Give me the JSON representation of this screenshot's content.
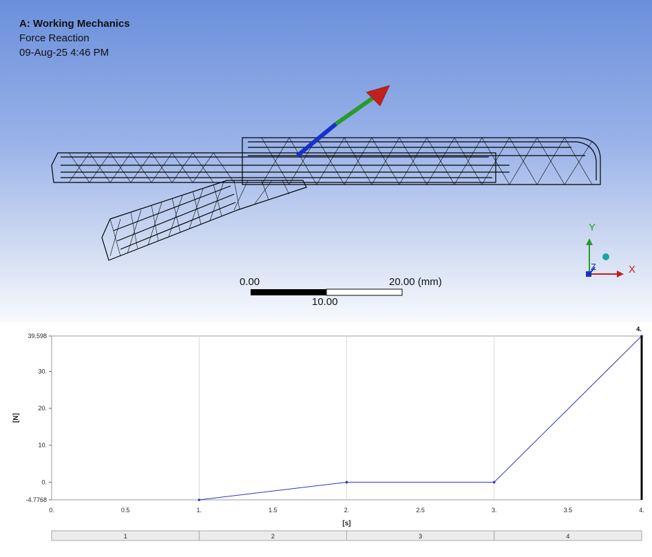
{
  "viewport": {
    "project": "A: Working Mechanics",
    "result": "Force Reaction",
    "timestamp": "09-Aug-25 4:46 PM",
    "scale": {
      "left": "0.00",
      "mid": "10.00",
      "right": "20.00",
      "unit": "(mm)"
    },
    "triad": {
      "x": "X",
      "y": "Y",
      "z": "Z"
    }
  },
  "colors": {
    "arrow_red": "#c0201e",
    "arrow_green": "#2a9a2a",
    "arrow_blue": "#1633c4",
    "series": "#2d32c8"
  },
  "chart_data": {
    "type": "line",
    "xlabel": "[s]",
    "ylabel": "[N]",
    "x": [
      1,
      2,
      3,
      4
    ],
    "y": [
      -4.7768,
      0,
      0,
      39.598
    ],
    "xlim": [
      0,
      4
    ],
    "ylim": [
      -4.7768,
      39.598
    ],
    "xticks": [
      "0.",
      "0.5",
      "1.",
      "1.5",
      "2.",
      "2.5",
      "3.",
      "3.5",
      "4."
    ],
    "yticks": [
      {
        "v": 39.598,
        "label": "39.598"
      },
      {
        "v": 30,
        "label": "30."
      },
      {
        "v": 20,
        "label": "20."
      },
      {
        "v": 10,
        "label": "10."
      },
      {
        "v": 0,
        "label": "0."
      },
      {
        "v": -4.7768,
        "label": "-4.7768"
      }
    ],
    "cursor_label": "4.",
    "steps": [
      "1",
      "2",
      "3",
      "4"
    ],
    "grid": true
  }
}
